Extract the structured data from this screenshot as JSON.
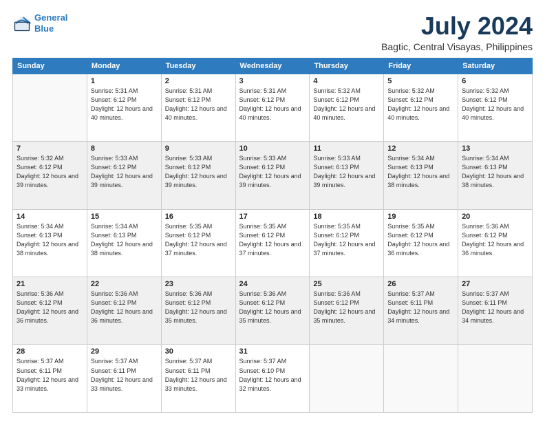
{
  "logo": {
    "line1": "General",
    "line2": "Blue"
  },
  "title": "July 2024",
  "location": "Bagtic, Central Visayas, Philippines",
  "weekdays": [
    "Sunday",
    "Monday",
    "Tuesday",
    "Wednesday",
    "Thursday",
    "Friday",
    "Saturday"
  ],
  "weeks": [
    [
      {
        "day": "",
        "sunrise": "",
        "sunset": "",
        "daylight": ""
      },
      {
        "day": "1",
        "sunrise": "Sunrise: 5:31 AM",
        "sunset": "Sunset: 6:12 PM",
        "daylight": "Daylight: 12 hours and 40 minutes."
      },
      {
        "day": "2",
        "sunrise": "Sunrise: 5:31 AM",
        "sunset": "Sunset: 6:12 PM",
        "daylight": "Daylight: 12 hours and 40 minutes."
      },
      {
        "day": "3",
        "sunrise": "Sunrise: 5:31 AM",
        "sunset": "Sunset: 6:12 PM",
        "daylight": "Daylight: 12 hours and 40 minutes."
      },
      {
        "day": "4",
        "sunrise": "Sunrise: 5:32 AM",
        "sunset": "Sunset: 6:12 PM",
        "daylight": "Daylight: 12 hours and 40 minutes."
      },
      {
        "day": "5",
        "sunrise": "Sunrise: 5:32 AM",
        "sunset": "Sunset: 6:12 PM",
        "daylight": "Daylight: 12 hours and 40 minutes."
      },
      {
        "day": "6",
        "sunrise": "Sunrise: 5:32 AM",
        "sunset": "Sunset: 6:12 PM",
        "daylight": "Daylight: 12 hours and 40 minutes."
      }
    ],
    [
      {
        "day": "7",
        "sunrise": "Sunrise: 5:32 AM",
        "sunset": "Sunset: 6:12 PM",
        "daylight": "Daylight: 12 hours and 39 minutes."
      },
      {
        "day": "8",
        "sunrise": "Sunrise: 5:33 AM",
        "sunset": "Sunset: 6:12 PM",
        "daylight": "Daylight: 12 hours and 39 minutes."
      },
      {
        "day": "9",
        "sunrise": "Sunrise: 5:33 AM",
        "sunset": "Sunset: 6:12 PM",
        "daylight": "Daylight: 12 hours and 39 minutes."
      },
      {
        "day": "10",
        "sunrise": "Sunrise: 5:33 AM",
        "sunset": "Sunset: 6:12 PM",
        "daylight": "Daylight: 12 hours and 39 minutes."
      },
      {
        "day": "11",
        "sunrise": "Sunrise: 5:33 AM",
        "sunset": "Sunset: 6:13 PM",
        "daylight": "Daylight: 12 hours and 39 minutes."
      },
      {
        "day": "12",
        "sunrise": "Sunrise: 5:34 AM",
        "sunset": "Sunset: 6:13 PM",
        "daylight": "Daylight: 12 hours and 38 minutes."
      },
      {
        "day": "13",
        "sunrise": "Sunrise: 5:34 AM",
        "sunset": "Sunset: 6:13 PM",
        "daylight": "Daylight: 12 hours and 38 minutes."
      }
    ],
    [
      {
        "day": "14",
        "sunrise": "Sunrise: 5:34 AM",
        "sunset": "Sunset: 6:13 PM",
        "daylight": "Daylight: 12 hours and 38 minutes."
      },
      {
        "day": "15",
        "sunrise": "Sunrise: 5:34 AM",
        "sunset": "Sunset: 6:13 PM",
        "daylight": "Daylight: 12 hours and 38 minutes."
      },
      {
        "day": "16",
        "sunrise": "Sunrise: 5:35 AM",
        "sunset": "Sunset: 6:12 PM",
        "daylight": "Daylight: 12 hours and 37 minutes."
      },
      {
        "day": "17",
        "sunrise": "Sunrise: 5:35 AM",
        "sunset": "Sunset: 6:12 PM",
        "daylight": "Daylight: 12 hours and 37 minutes."
      },
      {
        "day": "18",
        "sunrise": "Sunrise: 5:35 AM",
        "sunset": "Sunset: 6:12 PM",
        "daylight": "Daylight: 12 hours and 37 minutes."
      },
      {
        "day": "19",
        "sunrise": "Sunrise: 5:35 AM",
        "sunset": "Sunset: 6:12 PM",
        "daylight": "Daylight: 12 hours and 36 minutes."
      },
      {
        "day": "20",
        "sunrise": "Sunrise: 5:36 AM",
        "sunset": "Sunset: 6:12 PM",
        "daylight": "Daylight: 12 hours and 36 minutes."
      }
    ],
    [
      {
        "day": "21",
        "sunrise": "Sunrise: 5:36 AM",
        "sunset": "Sunset: 6:12 PM",
        "daylight": "Daylight: 12 hours and 36 minutes."
      },
      {
        "day": "22",
        "sunrise": "Sunrise: 5:36 AM",
        "sunset": "Sunset: 6:12 PM",
        "daylight": "Daylight: 12 hours and 36 minutes."
      },
      {
        "day": "23",
        "sunrise": "Sunrise: 5:36 AM",
        "sunset": "Sunset: 6:12 PM",
        "daylight": "Daylight: 12 hours and 35 minutes."
      },
      {
        "day": "24",
        "sunrise": "Sunrise: 5:36 AM",
        "sunset": "Sunset: 6:12 PM",
        "daylight": "Daylight: 12 hours and 35 minutes."
      },
      {
        "day": "25",
        "sunrise": "Sunrise: 5:36 AM",
        "sunset": "Sunset: 6:12 PM",
        "daylight": "Daylight: 12 hours and 35 minutes."
      },
      {
        "day": "26",
        "sunrise": "Sunrise: 5:37 AM",
        "sunset": "Sunset: 6:11 PM",
        "daylight": "Daylight: 12 hours and 34 minutes."
      },
      {
        "day": "27",
        "sunrise": "Sunrise: 5:37 AM",
        "sunset": "Sunset: 6:11 PM",
        "daylight": "Daylight: 12 hours and 34 minutes."
      }
    ],
    [
      {
        "day": "28",
        "sunrise": "Sunrise: 5:37 AM",
        "sunset": "Sunset: 6:11 PM",
        "daylight": "Daylight: 12 hours and 33 minutes."
      },
      {
        "day": "29",
        "sunrise": "Sunrise: 5:37 AM",
        "sunset": "Sunset: 6:11 PM",
        "daylight": "Daylight: 12 hours and 33 minutes."
      },
      {
        "day": "30",
        "sunrise": "Sunrise: 5:37 AM",
        "sunset": "Sunset: 6:11 PM",
        "daylight": "Daylight: 12 hours and 33 minutes."
      },
      {
        "day": "31",
        "sunrise": "Sunrise: 5:37 AM",
        "sunset": "Sunset: 6:10 PM",
        "daylight": "Daylight: 12 hours and 32 minutes."
      },
      {
        "day": "",
        "sunrise": "",
        "sunset": "",
        "daylight": ""
      },
      {
        "day": "",
        "sunrise": "",
        "sunset": "",
        "daylight": ""
      },
      {
        "day": "",
        "sunrise": "",
        "sunset": "",
        "daylight": ""
      }
    ]
  ]
}
